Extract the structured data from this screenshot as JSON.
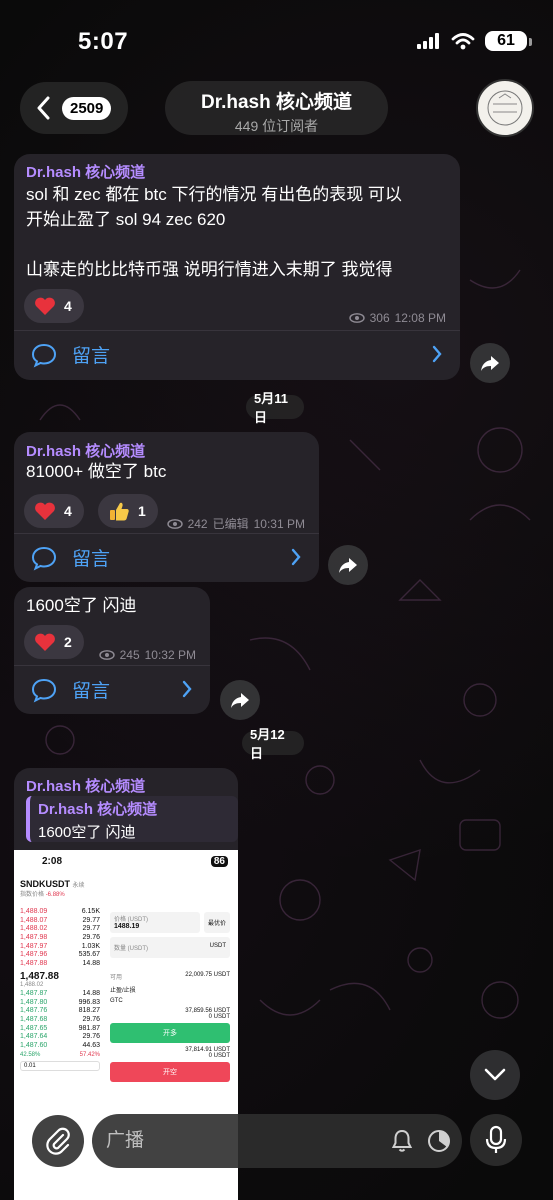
{
  "status_bar": {
    "time": "5:07",
    "battery": "61"
  },
  "header": {
    "back_count": "2509",
    "title": "Dr.hash 核心频道",
    "subtitle": "449 位订阅者"
  },
  "messages": [
    {
      "sender": "Dr.hash 核心频道",
      "text_lines": [
        "sol 和 zec 都在 btc 下行的情况 有出色的表现 可以",
        "开始止盈了 sol 94  zec 620",
        "",
        "山寨走的比比特币强 说明行情进入末期了 我觉得"
      ],
      "reactions": [
        {
          "emoji": "heart",
          "count": "4"
        }
      ],
      "views": "306",
      "time": "12:08 PM",
      "comment_label": "留言"
    },
    {
      "sender": "Dr.hash 核心频道",
      "text": "81000+ 做空了 btc",
      "reactions": [
        {
          "emoji": "heart",
          "count": "4"
        },
        {
          "emoji": "thumbs-up",
          "count": "1"
        }
      ],
      "views": "242",
      "edited": "已编辑",
      "time": "10:31 PM",
      "comment_label": "留言"
    },
    {
      "text": "1600空了 闪迪",
      "reactions": [
        {
          "emoji": "heart",
          "count": "2"
        }
      ],
      "views": "245",
      "time": "10:32 PM",
      "comment_label": "留言"
    },
    {
      "sender": "Dr.hash 核心频道",
      "reply_sender": "Dr.hash 核心频道",
      "reply_text": "1600空了 闪迪",
      "screenshot": {
        "time": "2:08",
        "battery": "86",
        "symbol": "SNDKUSDT",
        "symbol_tag": "永续",
        "change_label": "指数价格",
        "change": "-6.88%",
        "asks": [
          [
            "1,488.09",
            "6.15K"
          ],
          [
            "1,488.07",
            "29.77"
          ],
          [
            "1,488.02",
            "29.77"
          ],
          [
            "1,487.98",
            "29.76"
          ],
          [
            "1,487.97",
            "1.03K"
          ],
          [
            "1,487.96",
            "535.67"
          ],
          [
            "1,487.88",
            "14.88"
          ]
        ],
        "last_price": "1,487.88",
        "mark_price": "1,488.02",
        "bids": [
          [
            "1,487.87",
            "14.88"
          ],
          [
            "1,487.80",
            "996.83"
          ],
          [
            "1,487.76",
            "818.27"
          ],
          [
            "1,487.68",
            "29.76"
          ],
          [
            "1,487.65",
            "981.87"
          ],
          [
            "1,487.64",
            "29.76"
          ],
          [
            "1,487.60",
            "44.63"
          ]
        ],
        "ratio_left": "42.58%",
        "ratio_right": "57.42%",
        "depth": "0.01",
        "price_label": "价格 (USDT)",
        "price_value": "1488.19",
        "best_price": "最优价",
        "qty_label": "数量 (USDT)",
        "unit": "USDT",
        "available_label": "可用",
        "available": "22,009.75 USDT",
        "tp_sl": "止盈/止损",
        "gtc": "GTC",
        "can_open_1": "37,859.56 USDT",
        "margin_1": "0 USDT",
        "long_btn": "开多",
        "can_open_2": "37,814.91 USDT",
        "margin_2": "0 USDT",
        "short_btn": "开空"
      }
    }
  ],
  "date_separators": [
    "5月11日",
    "5月12日"
  ],
  "input": {
    "placeholder": "广播"
  }
}
